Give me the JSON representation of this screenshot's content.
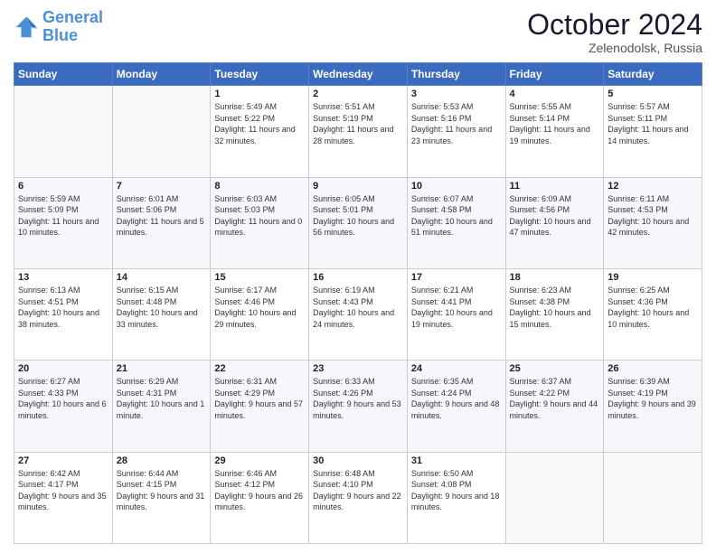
{
  "header": {
    "logo_line1": "General",
    "logo_line2": "Blue",
    "month": "October 2024",
    "location": "Zelenodolsk, Russia"
  },
  "weekdays": [
    "Sunday",
    "Monday",
    "Tuesday",
    "Wednesday",
    "Thursday",
    "Friday",
    "Saturday"
  ],
  "weeks": [
    [
      {
        "day": "",
        "sunrise": "",
        "sunset": "",
        "daylight": ""
      },
      {
        "day": "",
        "sunrise": "",
        "sunset": "",
        "daylight": ""
      },
      {
        "day": "1",
        "sunrise": "Sunrise: 5:49 AM",
        "sunset": "Sunset: 5:22 PM",
        "daylight": "Daylight: 11 hours and 32 minutes."
      },
      {
        "day": "2",
        "sunrise": "Sunrise: 5:51 AM",
        "sunset": "Sunset: 5:19 PM",
        "daylight": "Daylight: 11 hours and 28 minutes."
      },
      {
        "day": "3",
        "sunrise": "Sunrise: 5:53 AM",
        "sunset": "Sunset: 5:16 PM",
        "daylight": "Daylight: 11 hours and 23 minutes."
      },
      {
        "day": "4",
        "sunrise": "Sunrise: 5:55 AM",
        "sunset": "Sunset: 5:14 PM",
        "daylight": "Daylight: 11 hours and 19 minutes."
      },
      {
        "day": "5",
        "sunrise": "Sunrise: 5:57 AM",
        "sunset": "Sunset: 5:11 PM",
        "daylight": "Daylight: 11 hours and 14 minutes."
      }
    ],
    [
      {
        "day": "6",
        "sunrise": "Sunrise: 5:59 AM",
        "sunset": "Sunset: 5:09 PM",
        "daylight": "Daylight: 11 hours and 10 minutes."
      },
      {
        "day": "7",
        "sunrise": "Sunrise: 6:01 AM",
        "sunset": "Sunset: 5:06 PM",
        "daylight": "Daylight: 11 hours and 5 minutes."
      },
      {
        "day": "8",
        "sunrise": "Sunrise: 6:03 AM",
        "sunset": "Sunset: 5:03 PM",
        "daylight": "Daylight: 11 hours and 0 minutes."
      },
      {
        "day": "9",
        "sunrise": "Sunrise: 6:05 AM",
        "sunset": "Sunset: 5:01 PM",
        "daylight": "Daylight: 10 hours and 56 minutes."
      },
      {
        "day": "10",
        "sunrise": "Sunrise: 6:07 AM",
        "sunset": "Sunset: 4:58 PM",
        "daylight": "Daylight: 10 hours and 51 minutes."
      },
      {
        "day": "11",
        "sunrise": "Sunrise: 6:09 AM",
        "sunset": "Sunset: 4:56 PM",
        "daylight": "Daylight: 10 hours and 47 minutes."
      },
      {
        "day": "12",
        "sunrise": "Sunrise: 6:11 AM",
        "sunset": "Sunset: 4:53 PM",
        "daylight": "Daylight: 10 hours and 42 minutes."
      }
    ],
    [
      {
        "day": "13",
        "sunrise": "Sunrise: 6:13 AM",
        "sunset": "Sunset: 4:51 PM",
        "daylight": "Daylight: 10 hours and 38 minutes."
      },
      {
        "day": "14",
        "sunrise": "Sunrise: 6:15 AM",
        "sunset": "Sunset: 4:48 PM",
        "daylight": "Daylight: 10 hours and 33 minutes."
      },
      {
        "day": "15",
        "sunrise": "Sunrise: 6:17 AM",
        "sunset": "Sunset: 4:46 PM",
        "daylight": "Daylight: 10 hours and 29 minutes."
      },
      {
        "day": "16",
        "sunrise": "Sunrise: 6:19 AM",
        "sunset": "Sunset: 4:43 PM",
        "daylight": "Daylight: 10 hours and 24 minutes."
      },
      {
        "day": "17",
        "sunrise": "Sunrise: 6:21 AM",
        "sunset": "Sunset: 4:41 PM",
        "daylight": "Daylight: 10 hours and 19 minutes."
      },
      {
        "day": "18",
        "sunrise": "Sunrise: 6:23 AM",
        "sunset": "Sunset: 4:38 PM",
        "daylight": "Daylight: 10 hours and 15 minutes."
      },
      {
        "day": "19",
        "sunrise": "Sunrise: 6:25 AM",
        "sunset": "Sunset: 4:36 PM",
        "daylight": "Daylight: 10 hours and 10 minutes."
      }
    ],
    [
      {
        "day": "20",
        "sunrise": "Sunrise: 6:27 AM",
        "sunset": "Sunset: 4:33 PM",
        "daylight": "Daylight: 10 hours and 6 minutes."
      },
      {
        "day": "21",
        "sunrise": "Sunrise: 6:29 AM",
        "sunset": "Sunset: 4:31 PM",
        "daylight": "Daylight: 10 hours and 1 minute."
      },
      {
        "day": "22",
        "sunrise": "Sunrise: 6:31 AM",
        "sunset": "Sunset: 4:29 PM",
        "daylight": "Daylight: 9 hours and 57 minutes."
      },
      {
        "day": "23",
        "sunrise": "Sunrise: 6:33 AM",
        "sunset": "Sunset: 4:26 PM",
        "daylight": "Daylight: 9 hours and 53 minutes."
      },
      {
        "day": "24",
        "sunrise": "Sunrise: 6:35 AM",
        "sunset": "Sunset: 4:24 PM",
        "daylight": "Daylight: 9 hours and 48 minutes."
      },
      {
        "day": "25",
        "sunrise": "Sunrise: 6:37 AM",
        "sunset": "Sunset: 4:22 PM",
        "daylight": "Daylight: 9 hours and 44 minutes."
      },
      {
        "day": "26",
        "sunrise": "Sunrise: 6:39 AM",
        "sunset": "Sunset: 4:19 PM",
        "daylight": "Daylight: 9 hours and 39 minutes."
      }
    ],
    [
      {
        "day": "27",
        "sunrise": "Sunrise: 6:42 AM",
        "sunset": "Sunset: 4:17 PM",
        "daylight": "Daylight: 9 hours and 35 minutes."
      },
      {
        "day": "28",
        "sunrise": "Sunrise: 6:44 AM",
        "sunset": "Sunset: 4:15 PM",
        "daylight": "Daylight: 9 hours and 31 minutes."
      },
      {
        "day": "29",
        "sunrise": "Sunrise: 6:46 AM",
        "sunset": "Sunset: 4:12 PM",
        "daylight": "Daylight: 9 hours and 26 minutes."
      },
      {
        "day": "30",
        "sunrise": "Sunrise: 6:48 AM",
        "sunset": "Sunset: 4:10 PM",
        "daylight": "Daylight: 9 hours and 22 minutes."
      },
      {
        "day": "31",
        "sunrise": "Sunrise: 6:50 AM",
        "sunset": "Sunset: 4:08 PM",
        "daylight": "Daylight: 9 hours and 18 minutes."
      },
      {
        "day": "",
        "sunrise": "",
        "sunset": "",
        "daylight": ""
      },
      {
        "day": "",
        "sunrise": "",
        "sunset": "",
        "daylight": ""
      }
    ]
  ]
}
